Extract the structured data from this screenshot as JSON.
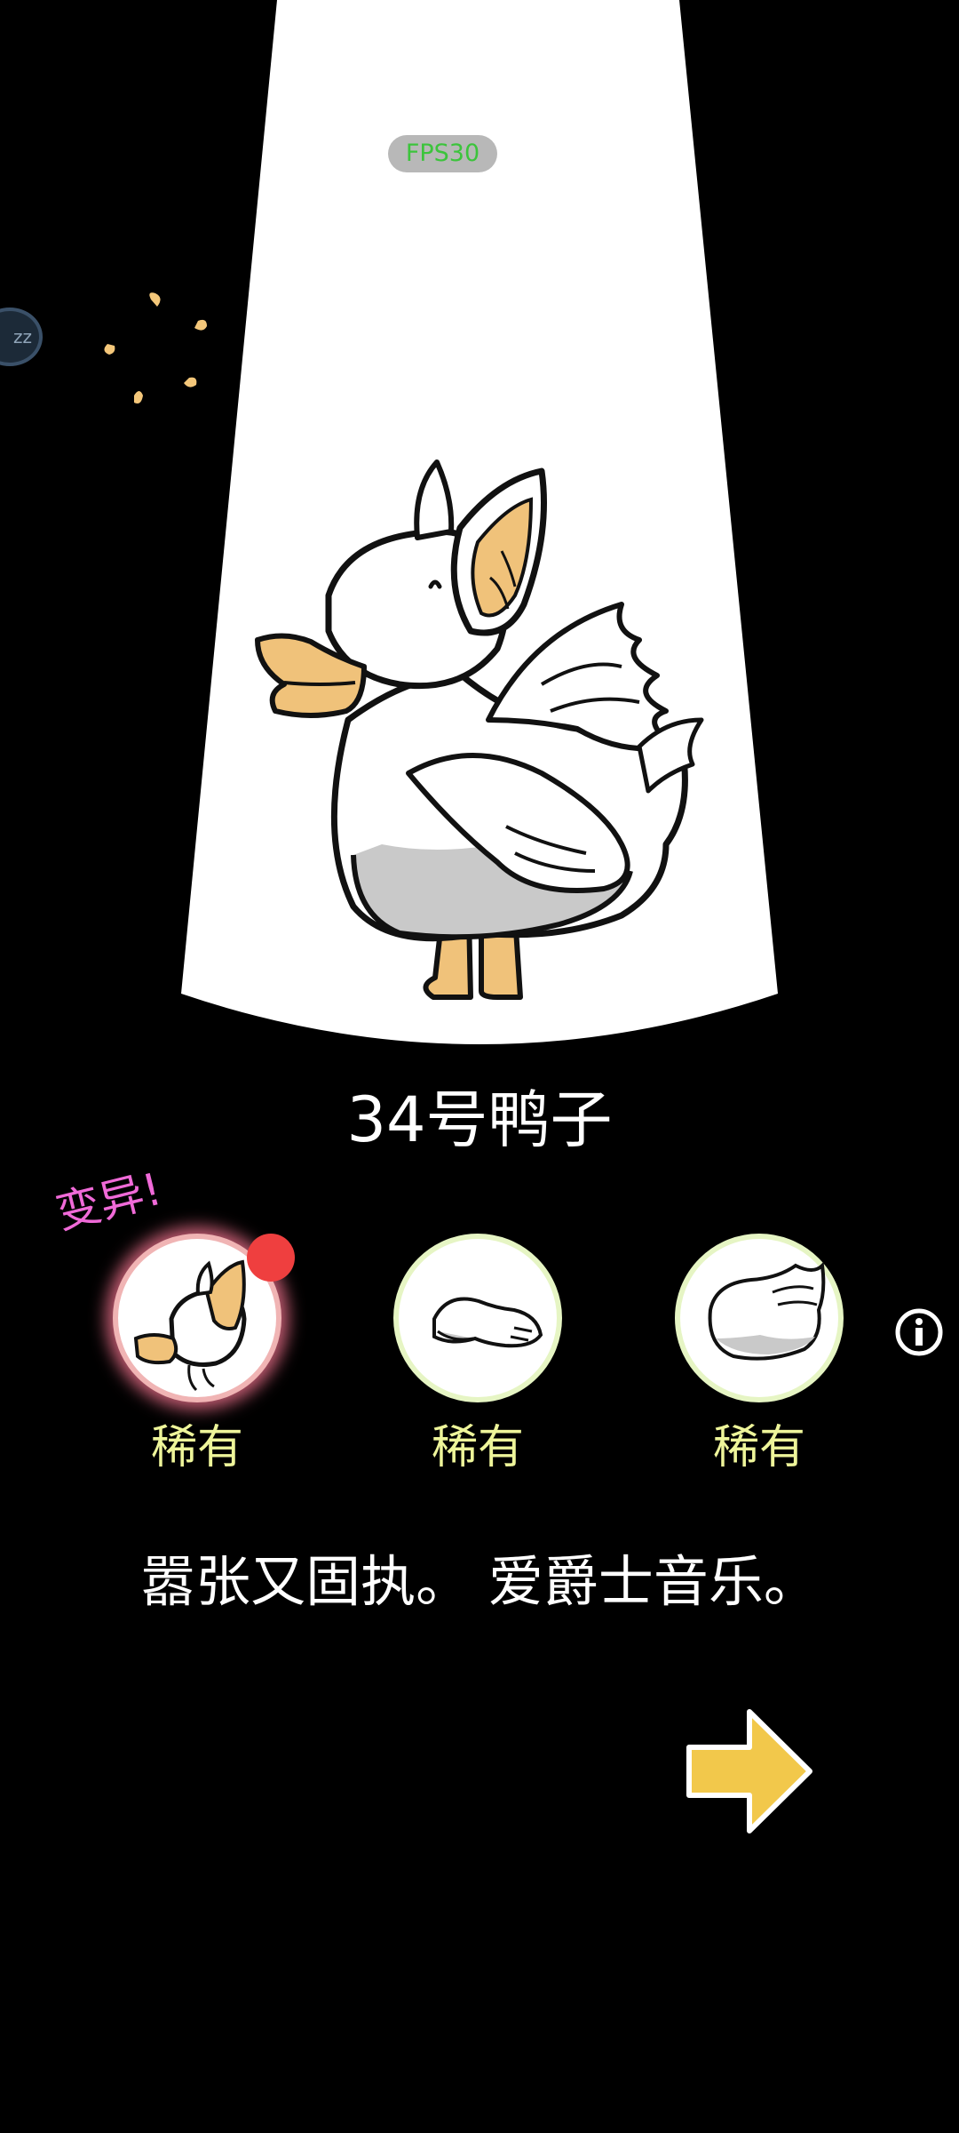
{
  "hud": {
    "fps_label": "FPS30",
    "sleep_label": "zz"
  },
  "duck": {
    "name": "34号鸭子",
    "mutation_label": "变异!",
    "description": "嚣张又固执。 爱爵士音乐。",
    "parts": [
      {
        "id": "head",
        "rarity": "稀有",
        "selected": true,
        "has_notification": true
      },
      {
        "id": "wing",
        "rarity": "稀有",
        "selected": false,
        "has_notification": false
      },
      {
        "id": "body",
        "rarity": "稀有",
        "selected": false,
        "has_notification": false
      }
    ]
  },
  "colors": {
    "background": "#000000",
    "spotlight": "#ffffff",
    "rarity_text": "#eef59a",
    "mutation_text": "#f06ad8",
    "selected_glow": "#ff7896",
    "arrow": "#f2c84b",
    "fps_text": "#3cc43c"
  },
  "icons": [
    "sparkle-icon",
    "info-icon",
    "next-arrow-icon",
    "notification-dot"
  ]
}
